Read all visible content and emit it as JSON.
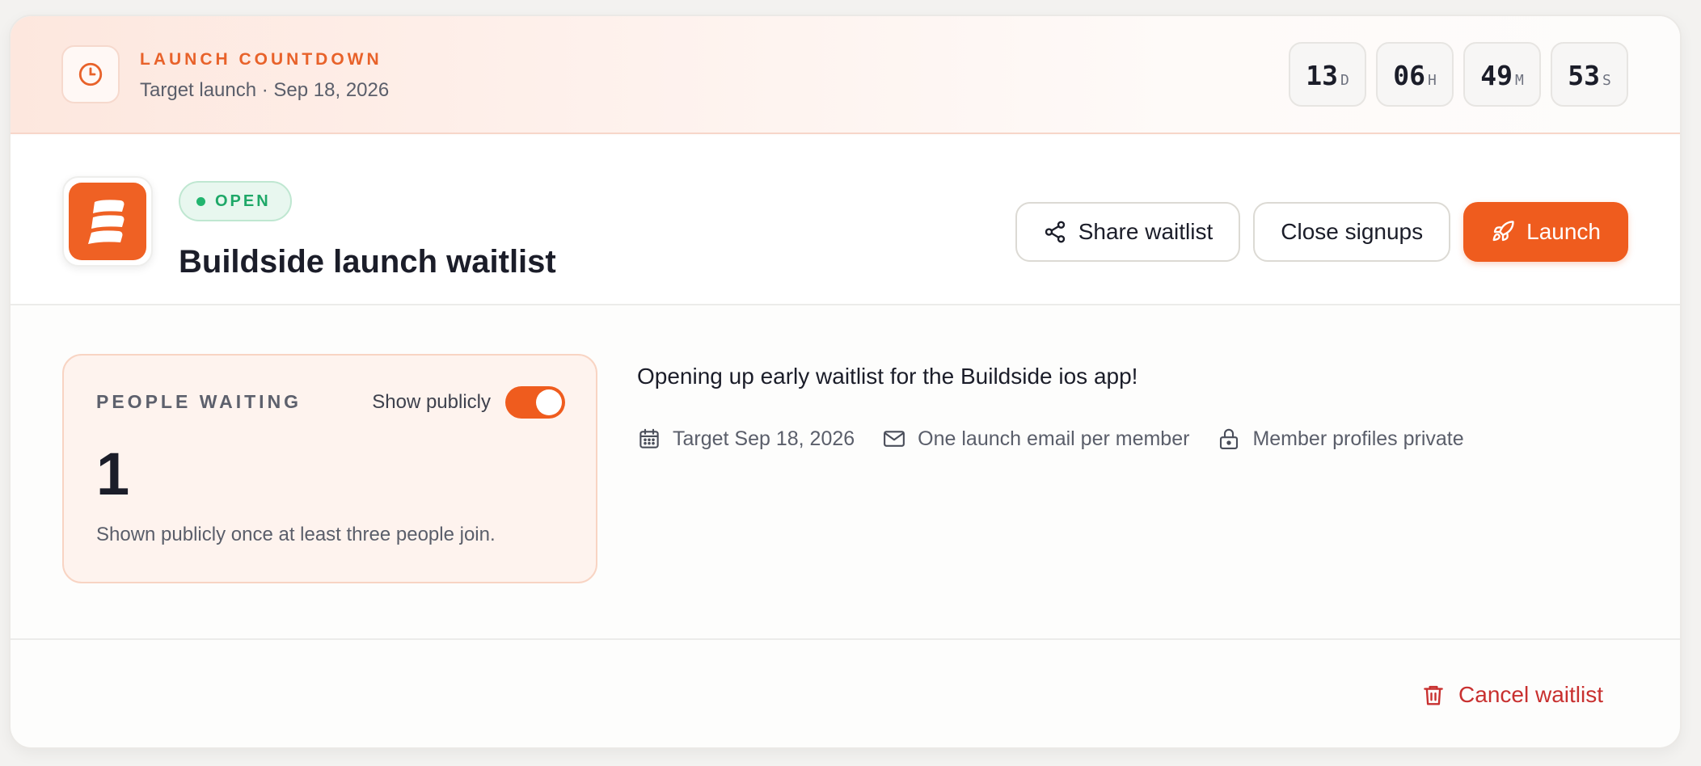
{
  "banner": {
    "kicker": "LAUNCH COUNTDOWN",
    "subtitle": "Target launch · Sep 18, 2026",
    "countdown": [
      {
        "value": "13",
        "unit": "D"
      },
      {
        "value": "06",
        "unit": "H"
      },
      {
        "value": "49",
        "unit": "M"
      },
      {
        "value": "53",
        "unit": "S"
      }
    ]
  },
  "header": {
    "status": "OPEN",
    "title": "Buildside launch waitlist",
    "actions": {
      "share": "Share waitlist",
      "close": "Close signups",
      "launch": "Launch"
    }
  },
  "stats": {
    "label": "PEOPLE WAITING",
    "toggle_label": "Show publicly",
    "toggle_on": true,
    "value": "1",
    "note": "Shown publicly once at least three people join."
  },
  "details": {
    "description": "Opening up early waitlist for the Buildside ios app!",
    "meta": [
      {
        "icon": "calendar-icon",
        "text": "Target Sep 18, 2026"
      },
      {
        "icon": "mail-icon",
        "text": "One launch email per member"
      },
      {
        "icon": "lock-icon",
        "text": "Member profiles private"
      }
    ]
  },
  "footer": {
    "cancel": "Cancel waitlist"
  },
  "colors": {
    "accent": "#ef5c1e",
    "success": "#1ea868",
    "danger": "#c8302f"
  }
}
